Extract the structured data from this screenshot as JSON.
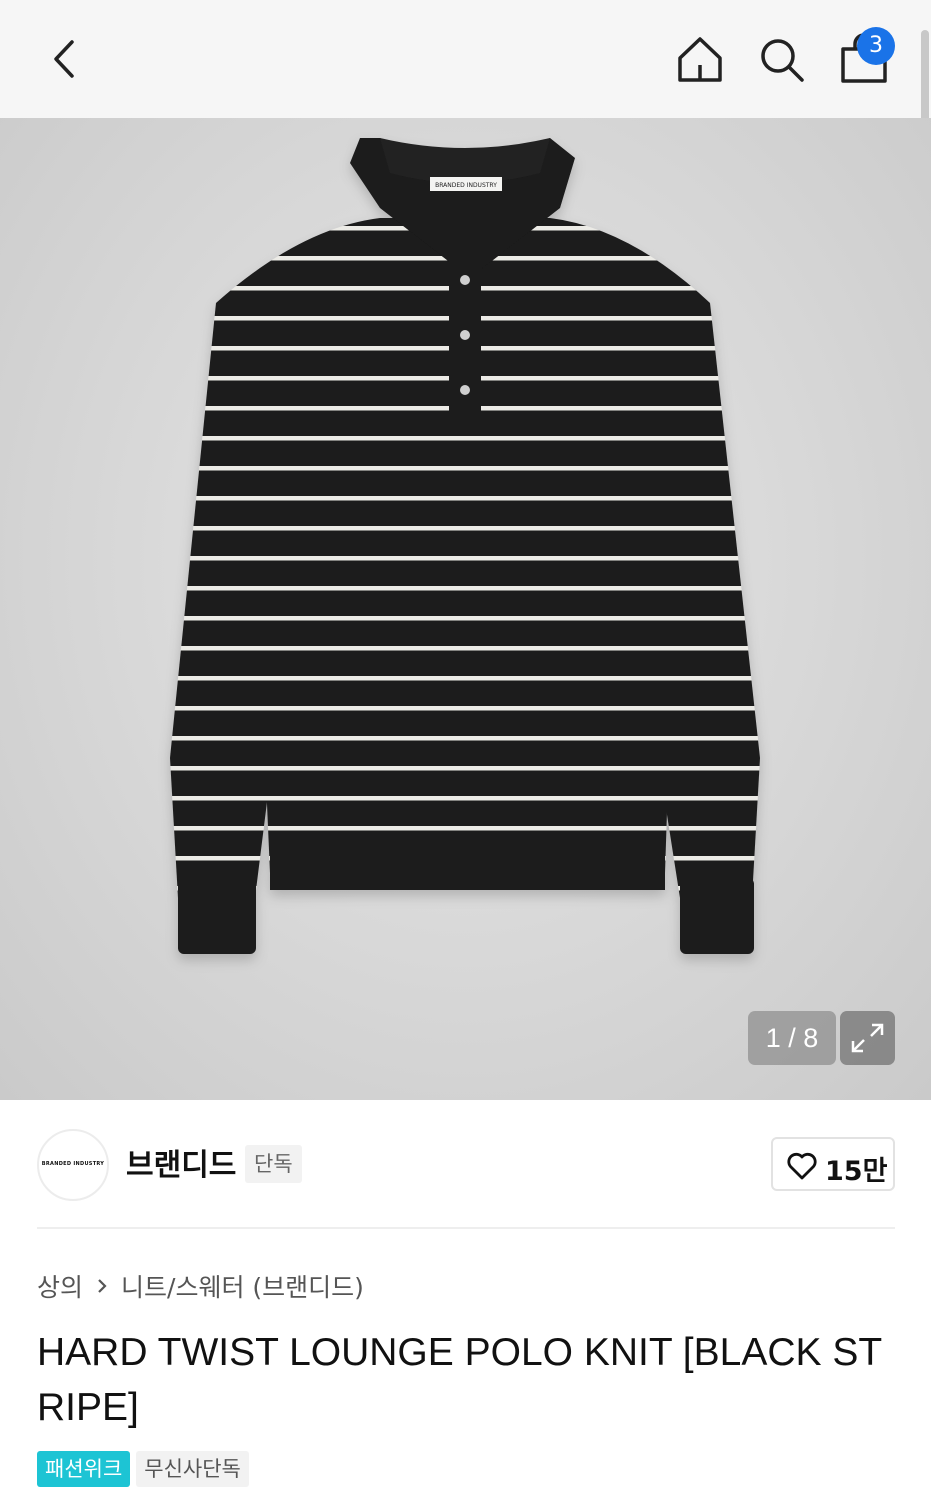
{
  "header": {
    "back_icon": "chevron-left-icon",
    "home_icon": "home-icon",
    "search_icon": "search-icon",
    "cart_icon": "shopping-bag-icon",
    "cart_count": "3"
  },
  "gallery": {
    "image_alt": "black and white striped polo knit sweater",
    "neck_label": "BRANDED INDUSTRY",
    "counter": "1 / 8",
    "expand_icon": "expand-arrows-icon"
  },
  "brand": {
    "logo_text": "BRANDED INDUSTRY",
    "name": "브랜디드",
    "tag": "단독",
    "like_icon": "heart-icon",
    "like_count": "15만"
  },
  "breadcrumb": {
    "category": "상의",
    "subcategory": "니트/스웨터 (브랜디드)"
  },
  "product": {
    "title": "HARD TWIST LOUNGE POLO KNIT [BLACK STRIPE]"
  },
  "tags": [
    {
      "label": "패션위크",
      "style": "accent"
    },
    {
      "label": "무신사단독",
      "style": "plain"
    }
  ],
  "colors": {
    "accent": "#1dc4d4",
    "badge": "#1a73e8",
    "sweater": "#1c1c1c",
    "stripe": "#ecebe6"
  }
}
